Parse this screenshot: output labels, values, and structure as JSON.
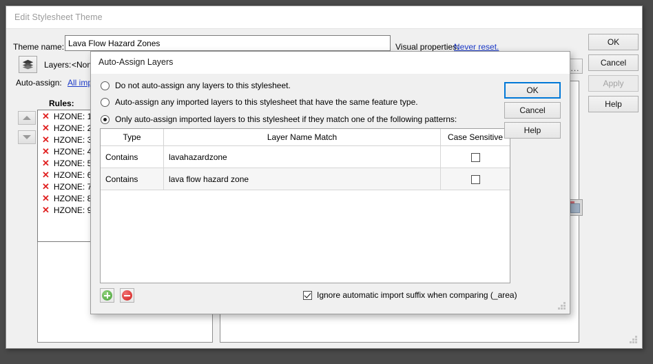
{
  "main_window": {
    "title": "Edit Stylesheet Theme",
    "theme_name_label": "Theme name:",
    "theme_name_value": "Lava Flow Hazard Zones",
    "visual_properties_label": "Visual properties:",
    "visual_properties_link": "Never reset.",
    "layers_label": "Layers:",
    "layers_value": "<None>",
    "layers_icon": "layers-stack-icon",
    "auto_assign_label": "Auto-assign:",
    "auto_assign_link": "All impo",
    "rules_label": "Rules:",
    "rules": [
      "HZONE: 1",
      "HZONE: 2",
      "HZONE: 3",
      "HZONE: 4",
      "HZONE: 5",
      "HZONE: 6",
      "HZONE: 7",
      "HZONE: 8",
      "HZONE: 9"
    ],
    "rule_status_icon": "red-x-icon",
    "move_up_icon": "triangle-up-icon",
    "move_down_icon": "triangle-down-icon",
    "ellipsis_button": "...",
    "buttons": [
      {
        "label": "OK",
        "state": "normal"
      },
      {
        "label": "Cancel",
        "state": "normal"
      },
      {
        "label": "Apply",
        "state": "disabled"
      },
      {
        "label": "Help",
        "state": "normal"
      }
    ]
  },
  "dialog": {
    "title": "Auto-Assign Layers",
    "options": [
      {
        "label": "Do not auto-assign any layers to this stylesheet.",
        "selected": false
      },
      {
        "label": "Auto-assign any imported layers to this stylesheet that have the same feature type.",
        "selected": false
      },
      {
        "label": "Only auto-assign imported layers to this stylesheet if they match one of the following patterns:",
        "selected": true
      }
    ],
    "table": {
      "columns": [
        "Type",
        "Layer Name Match",
        "Case Sensitive"
      ],
      "rows": [
        {
          "type": "Contains",
          "match": "lavahazardzone",
          "case_sensitive": false
        },
        {
          "type": "Contains",
          "match": "lava flow hazard zone",
          "case_sensitive": false
        }
      ]
    },
    "add_button_icon": "plus-circle-icon",
    "remove_button_icon": "minus-circle-icon",
    "ignore_suffix_label": "Ignore automatic import suffix when comparing (_area)",
    "ignore_suffix_checked": true,
    "buttons": [
      {
        "label": "OK",
        "state": "default"
      },
      {
        "label": "Cancel",
        "state": "normal"
      },
      {
        "label": "Help",
        "state": "normal"
      }
    ]
  },
  "colors": {
    "accent": "#0078d7",
    "link": "#1a39c8",
    "error": "#e02020",
    "add": "#4aa33a",
    "remove": "#d2201e",
    "desktop": "#4a4a4a"
  }
}
